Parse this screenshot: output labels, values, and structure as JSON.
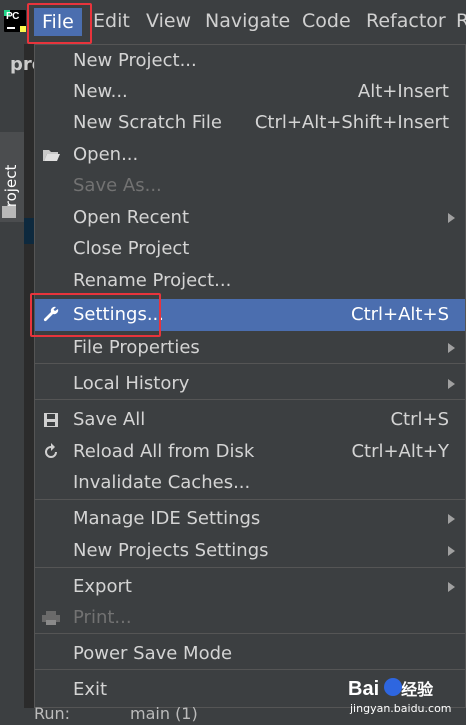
{
  "menubar": {
    "logo_text": "PC",
    "items": [
      "File",
      "Edit",
      "View",
      "Navigate",
      "Code",
      "Refactor",
      "R"
    ]
  },
  "behind": {
    "project_tab": "Project",
    "header": "pro"
  },
  "file_menu": {
    "items": [
      {
        "label": "New Project...",
        "shortcut": "",
        "icon": "",
        "submenu": false,
        "disabled": false
      },
      {
        "label": "New...",
        "shortcut": "Alt+Insert",
        "icon": "",
        "submenu": false,
        "disabled": false
      },
      {
        "label": "New Scratch File",
        "shortcut": "Ctrl+Alt+Shift+Insert",
        "icon": "",
        "submenu": false,
        "disabled": false
      },
      {
        "label": "Open...",
        "shortcut": "",
        "icon": "folder-open-icon",
        "submenu": false,
        "disabled": false
      },
      {
        "label": "Save As...",
        "shortcut": "",
        "icon": "",
        "submenu": false,
        "disabled": true
      },
      {
        "label": "Open Recent",
        "shortcut": "",
        "icon": "",
        "submenu": true,
        "disabled": false
      },
      {
        "label": "Close Project",
        "shortcut": "",
        "icon": "",
        "submenu": false,
        "disabled": false
      },
      {
        "label": "Rename Project...",
        "shortcut": "",
        "icon": "",
        "submenu": false,
        "disabled": false
      },
      {
        "label": "Settings...",
        "shortcut": "Ctrl+Alt+S",
        "icon": "wrench-icon",
        "submenu": false,
        "disabled": false,
        "selected": true
      },
      {
        "label": "File Properties",
        "shortcut": "",
        "icon": "",
        "submenu": true,
        "disabled": false
      },
      {
        "label": "Local History",
        "shortcut": "",
        "icon": "",
        "submenu": true,
        "disabled": false
      },
      {
        "label": "Save All",
        "shortcut": "Ctrl+S",
        "icon": "save-icon",
        "submenu": false,
        "disabled": false
      },
      {
        "label": "Reload All from Disk",
        "shortcut": "Ctrl+Alt+Y",
        "icon": "reload-icon",
        "submenu": false,
        "disabled": false
      },
      {
        "label": "Invalidate Caches...",
        "shortcut": "",
        "icon": "",
        "submenu": false,
        "disabled": false
      },
      {
        "label": "Manage IDE Settings",
        "shortcut": "",
        "icon": "",
        "submenu": true,
        "disabled": false
      },
      {
        "label": "New Projects Settings",
        "shortcut": "",
        "icon": "",
        "submenu": true,
        "disabled": false
      },
      {
        "label": "Export",
        "shortcut": "",
        "icon": "",
        "submenu": true,
        "disabled": false
      },
      {
        "label": "Print...",
        "shortcut": "",
        "icon": "printer-icon",
        "submenu": false,
        "disabled": true
      },
      {
        "label": "Power Save Mode",
        "shortcut": "",
        "icon": "",
        "submenu": false,
        "disabled": false
      },
      {
        "label": "Exit",
        "shortcut": "",
        "icon": "",
        "submenu": false,
        "disabled": false
      }
    ]
  },
  "bottom": {
    "run_label": "Run:",
    "tab_label": "main (1)"
  },
  "watermark": {
    "brand": "Bai",
    "brand2": "经验",
    "site": "jingyan.baidu.com"
  },
  "colors": {
    "selected": "#4b6eaf",
    "highlight_box": "#e8343c",
    "background": "#3c3f41"
  }
}
